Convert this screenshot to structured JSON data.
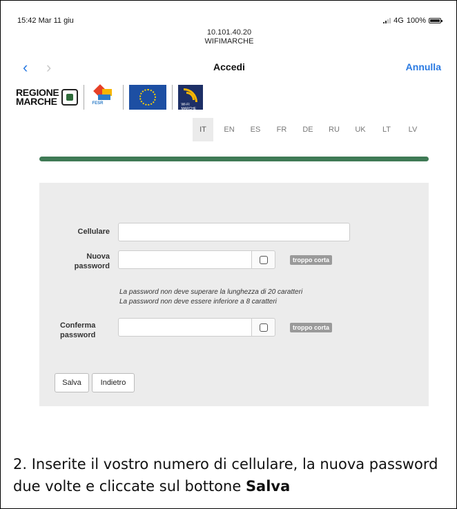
{
  "status_bar": {
    "time": "15:42",
    "date": "Mar 11 giu",
    "network": "4G",
    "battery": "100%"
  },
  "url_bar": {
    "ip": "10.101.40.20",
    "ssid": "WIFIMARCHE"
  },
  "nav": {
    "title": "Accedi",
    "cancel": "Annulla",
    "back_icon": "chevron-left-icon",
    "forward_icon": "chevron-right-icon"
  },
  "logos": {
    "regione_line1": "REGIONE",
    "regione_line2": "MARCHE",
    "fesr_text": "FESR",
    "wifi_text": "WI-FI MARCHE"
  },
  "languages": [
    "IT",
    "EN",
    "ES",
    "FR",
    "DE",
    "RU",
    "UK",
    "LT",
    "LV"
  ],
  "selected_language": "IT",
  "accent_color": "#3f7a55",
  "form": {
    "phone_label": "Cellulare",
    "phone_value": "",
    "new_password_label_1": "Nuova",
    "new_password_label_2": "password",
    "new_password_value": "",
    "new_password_strength": "troppo corta",
    "hint_1": "La password non deve superare la lunghezza di 20 caratteri",
    "hint_2": "La password non deve essere inferiore a 8 caratteri",
    "confirm_label_1": "Conferma",
    "confirm_label_2": "password",
    "confirm_value": "",
    "confirm_strength": "troppo corta",
    "save_button": "Salva",
    "back_button": "Indietro"
  },
  "caption": {
    "text": "2. Inserite il vostro numero di cellulare, la nuova password due volte e cliccate sul bottone ",
    "bold": "Salva"
  }
}
